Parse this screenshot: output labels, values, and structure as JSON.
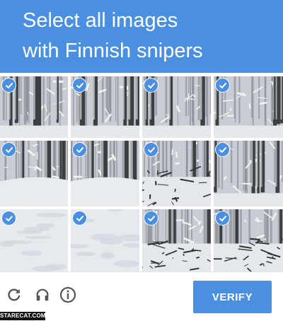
{
  "header": {
    "line1": "Select all images",
    "line2": "with Finnish snipers",
    "background": "#4a8fe0"
  },
  "grid": {
    "rows": 3,
    "cols": 4,
    "tiles": [
      {
        "row": 0,
        "col": 0,
        "selected": true,
        "scene": "forest"
      },
      {
        "row": 0,
        "col": 1,
        "selected": true,
        "scene": "forest"
      },
      {
        "row": 0,
        "col": 2,
        "selected": true,
        "scene": "forest"
      },
      {
        "row": 0,
        "col": 3,
        "selected": true,
        "scene": "forest"
      },
      {
        "row": 1,
        "col": 0,
        "selected": true,
        "scene": "forest-path"
      },
      {
        "row": 1,
        "col": 1,
        "selected": true,
        "scene": "forest-path"
      },
      {
        "row": 1,
        "col": 2,
        "selected": true,
        "scene": "brush"
      },
      {
        "row": 1,
        "col": 3,
        "selected": true,
        "scene": "forest"
      },
      {
        "row": 2,
        "col": 0,
        "selected": true,
        "scene": "snow"
      },
      {
        "row": 2,
        "col": 1,
        "selected": true,
        "scene": "snow"
      },
      {
        "row": 2,
        "col": 2,
        "selected": true,
        "scene": "brush"
      },
      {
        "row": 2,
        "col": 3,
        "selected": true,
        "scene": "brush"
      }
    ]
  },
  "footer": {
    "icons": [
      "reload-icon",
      "headphones-icon",
      "info-icon"
    ],
    "verify_label": "VERIFY"
  },
  "watermark": "STARECAT.COM",
  "colors": {
    "accent": "#4a8fe0",
    "icon": "#555555"
  }
}
